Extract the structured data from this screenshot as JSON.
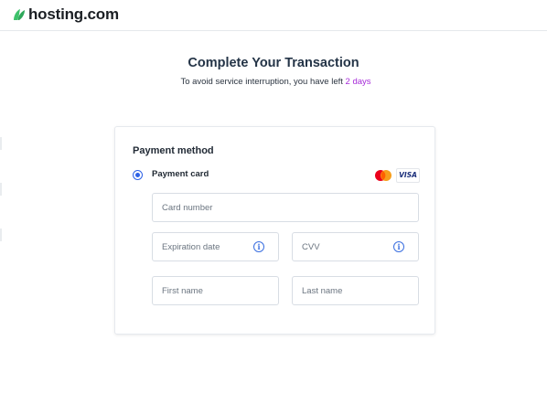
{
  "header": {
    "brand": "hosting.com",
    "logo_icon": "leaf-logo-icon",
    "brand_color": "#3ec26b"
  },
  "main": {
    "title": "Complete Your Transaction",
    "subtitle_prefix": "To avoid service interruption, you have left ",
    "days_left": "2 days",
    "days_color": "#a62bd8"
  },
  "payment": {
    "section_title": "Payment method",
    "option_label": "Payment card",
    "option_selected": true,
    "card_brands": [
      "mastercard-icon",
      "VISA"
    ],
    "fields": {
      "card_number": {
        "placeholder": "Card number",
        "value": ""
      },
      "expiration": {
        "placeholder": "Expiration date",
        "value": "",
        "info_icon": "info-icon"
      },
      "cvv": {
        "placeholder": "CVV",
        "value": "",
        "info_icon": "info-icon"
      },
      "first_name": {
        "placeholder": "First name",
        "value": ""
      },
      "last_name": {
        "placeholder": "Last name",
        "value": ""
      }
    },
    "accent_color": "#2e62e6"
  }
}
